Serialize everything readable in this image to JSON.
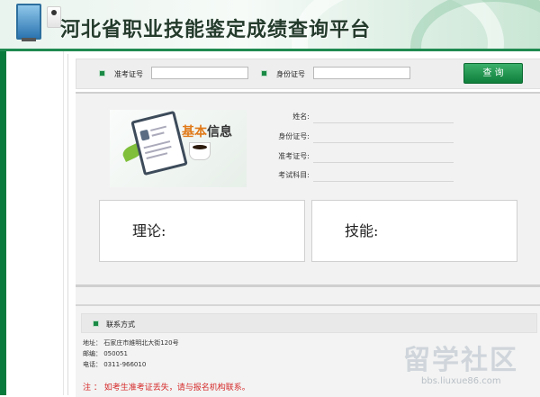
{
  "header": {
    "title": "河北省职业技能鉴定成绩查询平台"
  },
  "search": {
    "exam_no_label": "准考证号",
    "exam_no_value": "",
    "id_no_label": "身份证号",
    "id_no_value": "",
    "query_label": "查 询"
  },
  "basic_info": {
    "badge_part1": "基本",
    "badge_part2": "信息",
    "fields": [
      {
        "label": "姓名:",
        "value": ""
      },
      {
        "label": "身份证号:",
        "value": ""
      },
      {
        "label": "准考证号:",
        "value": ""
      },
      {
        "label": "考试科目:",
        "value": ""
      }
    ]
  },
  "scores": {
    "theory_label": "理论:",
    "skill_label": "技能:"
  },
  "contact": {
    "title": "联系方式",
    "address": "地址：  石家庄市維明北大街120号",
    "postcode": "邮编：  050051",
    "phone": "电话：  0311-966010",
    "note": "注 ： 如考生准考证丢失，请与报名机构联系。"
  },
  "watermark": {
    "text": "留学社区",
    "url": "bbs.liuxue86.com"
  },
  "colors": {
    "brand_green": "#0a7a3c",
    "button_green": "#1a8f4a",
    "note_red": "#d62a2a",
    "badge_orange": "#e07a1a"
  }
}
